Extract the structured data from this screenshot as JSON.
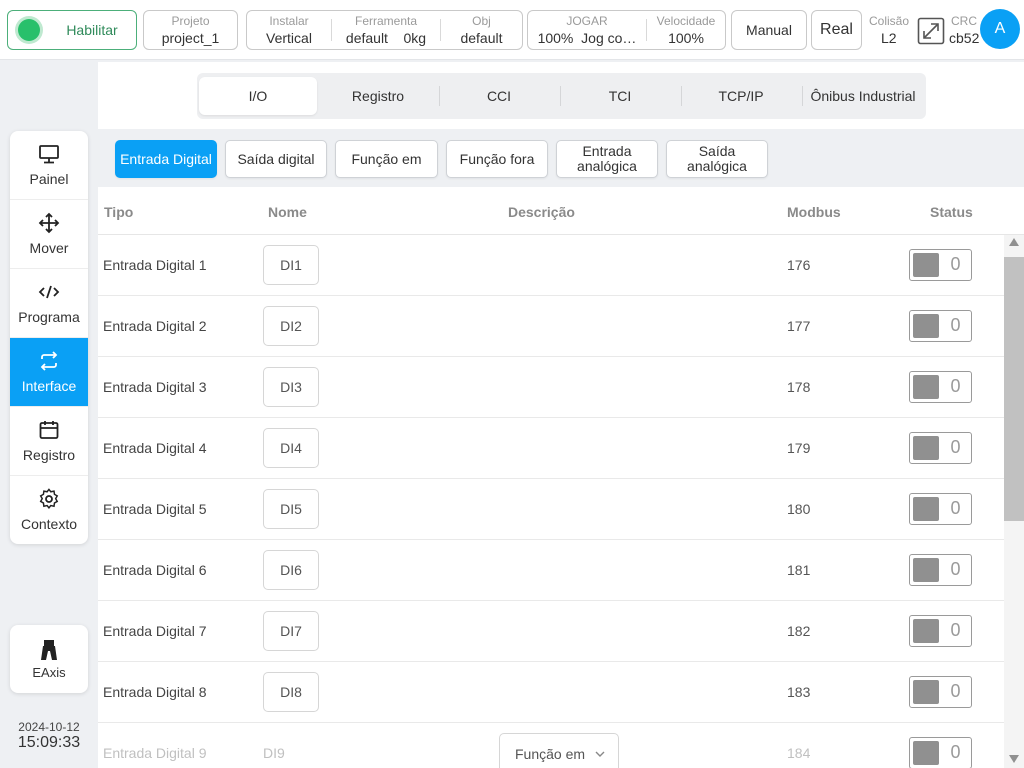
{
  "topbar": {
    "enable_label": "Habilitar",
    "projeto": {
      "caption": "Projeto",
      "value": "project_1"
    },
    "instalar": {
      "caption": "Instalar",
      "value": "Vertical"
    },
    "ferramenta": {
      "caption": "Ferramenta",
      "value": "default",
      "weight": "0kg"
    },
    "obj": {
      "caption": "Obj",
      "value": "default"
    },
    "jogar": {
      "caption": "JOGAR",
      "percent": "100%",
      "mode": "Jog co…"
    },
    "velocidade": {
      "caption": "Velocidade",
      "value": "100%"
    },
    "manual_label": "Manual",
    "real_label": "Real",
    "colisao": {
      "caption": "Colisão",
      "value": "L2"
    },
    "crc": {
      "caption": "CRC",
      "value": "cb52"
    },
    "avatar_letter": "A",
    "fullscreen_icon": "expand-icon"
  },
  "sidebar": {
    "items": [
      {
        "label": "Painel",
        "icon": "monitor-icon",
        "active": false
      },
      {
        "label": "Mover",
        "icon": "move-arrows-icon",
        "active": false
      },
      {
        "label": "Programa",
        "icon": "code-icon",
        "active": false
      },
      {
        "label": "Interface",
        "icon": "swap-arrows-icon",
        "active": true
      },
      {
        "label": "Registro",
        "icon": "calendar-icon",
        "active": false
      },
      {
        "label": "Contexto",
        "icon": "gear-icon",
        "active": false
      }
    ],
    "eaxis_label": "EAxis",
    "date": "2024-10-12",
    "time": "15:09:33"
  },
  "tabs": [
    "I/O",
    "Registro",
    "CCI",
    "TCI",
    "TCP/IP",
    "Ônibus Industrial"
  ],
  "active_tab": "I/O",
  "subtabs": {
    "entrada_digital": "Entrada Digital",
    "saida_digital": "Saída digital",
    "funcao_em": "Função em",
    "funcao_fora": "Função fora",
    "entrada_analogica": "Entrada analógica",
    "saida_analogica": "Saída analógica"
  },
  "table": {
    "headers": {
      "tipo": "Tipo",
      "nome": "Nome",
      "descricao": "Descrição",
      "modbus": "Modbus",
      "status": "Status"
    },
    "rows": [
      {
        "tipo": "Entrada Digital 1",
        "nome": "DI1",
        "modbus": "176",
        "status": "0"
      },
      {
        "tipo": "Entrada Digital 2",
        "nome": "DI2",
        "modbus": "177",
        "status": "0"
      },
      {
        "tipo": "Entrada Digital 3",
        "nome": "DI3",
        "modbus": "178",
        "status": "0"
      },
      {
        "tipo": "Entrada Digital 4",
        "nome": "DI4",
        "modbus": "179",
        "status": "0"
      },
      {
        "tipo": "Entrada Digital 5",
        "nome": "DI5",
        "modbus": "180",
        "status": "0"
      },
      {
        "tipo": "Entrada Digital 6",
        "nome": "DI6",
        "modbus": "181",
        "status": "0"
      },
      {
        "tipo": "Entrada Digital 7",
        "nome": "DI7",
        "modbus": "182",
        "status": "0"
      },
      {
        "tipo": "Entrada Digital 8",
        "nome": "DI8",
        "modbus": "183",
        "status": "0"
      },
      {
        "tipo": "Entrada Digital 9",
        "nome": "DI9",
        "modbus": "184",
        "status": "0",
        "descricao_select": "Função em"
      }
    ]
  },
  "colors": {
    "accent": "#0aa0f5",
    "enable_green": "#28c06b",
    "toggle_off": "#909090"
  }
}
